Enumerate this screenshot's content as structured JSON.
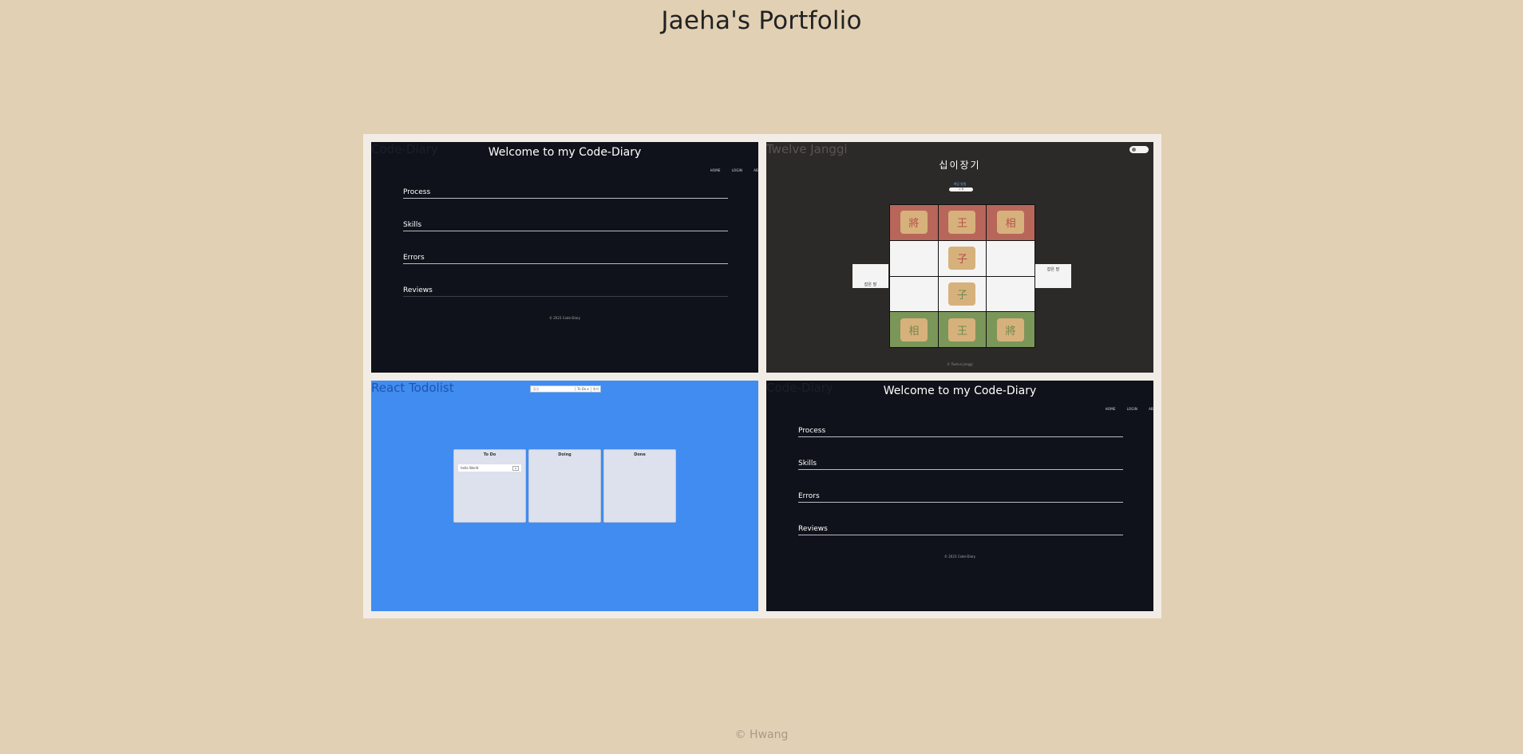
{
  "page": {
    "title": "Jaeha's Portfolio",
    "footer": "© Hwang"
  },
  "cards": [
    {
      "title": "Code-Diary",
      "header": "Welcome to my Code-Diary",
      "nav": [
        "HOME",
        "LOGIN",
        "AB"
      ],
      "items": [
        "Process",
        "Skills",
        "Errors",
        "Reviews"
      ],
      "footer": "© 2023 Code-Diary"
    },
    {
      "title": "Twelve Janggi",
      "heading": "십이장기",
      "link": "게임 방법",
      "button": "시 작",
      "board": [
        [
          {
            "p": "將"
          },
          {
            "p": "王"
          },
          {
            "p": "相"
          }
        ],
        [
          {
            "p": ""
          },
          {
            "p": "子"
          },
          {
            "p": ""
          }
        ],
        [
          {
            "p": ""
          },
          {
            "p": "子"
          },
          {
            "p": ""
          }
        ],
        [
          {
            "p": "相"
          },
          {
            "p": "王"
          },
          {
            "p": "將"
          }
        ]
      ],
      "left_capture": "잡은 말",
      "right_capture": "잡은 말",
      "footer": "© Twelve Janggi"
    },
    {
      "title": "React Todolist",
      "input_placeholder": "할일",
      "input_option": "To Do ▾",
      "input_add": "추가",
      "columns": [
        {
          "title": "To Do",
          "items": [
            {
              "text": "hello World",
              "del": "X"
            }
          ]
        },
        {
          "title": "Doing",
          "items": []
        },
        {
          "title": "Done",
          "items": []
        }
      ]
    },
    {
      "title": "Code-Diary",
      "header": "Welcome to my Code-Diary",
      "nav": [
        "HOME",
        "LOGIN",
        "AB"
      ],
      "items": [
        "Process",
        "Skills",
        "Errors",
        "Reviews"
      ],
      "footer": "© 2023 Code-Diary"
    }
  ],
  "colors": {
    "background": "#e2d0b4",
    "diary_bg": "#0f121a",
    "janggi_bg": "#2c2a28",
    "todo_bg": "#418cf0"
  }
}
